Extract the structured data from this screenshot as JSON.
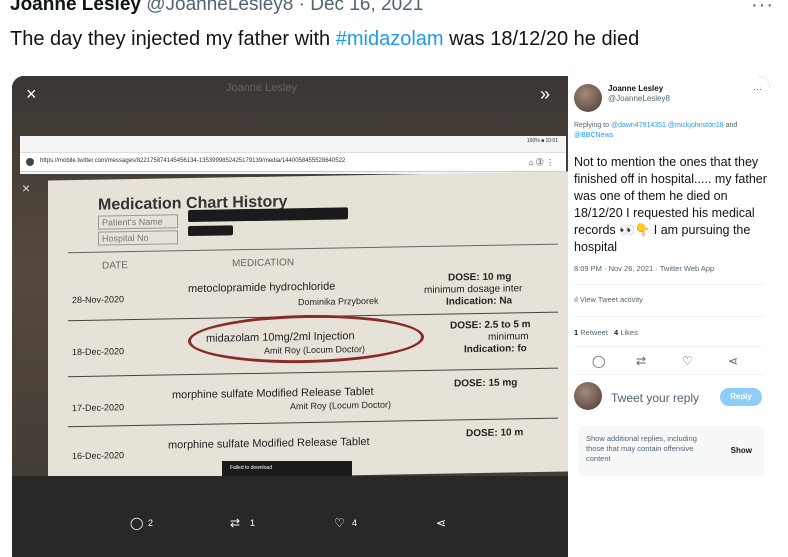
{
  "header": {
    "name": "Joanne Lesley",
    "handle": "@JoanneLesley8",
    "date": "· Dec 16, 2021",
    "more": "···"
  },
  "tweet": {
    "pre": "The day they injected my father with ",
    "hashtag": "#midazolam",
    "post": " was 18/12/20 he died"
  },
  "viewer": {
    "close": "×",
    "next": "»",
    "ghost_name": "Joanne Lesley",
    "browser": {
      "status": "100% ■ 10:01",
      "url": "https://mobile.twitter.com/messages/822175874145456134-1353999852425179139/media/1440058455528640522",
      "icons": "⌂ ⓷ ⋮"
    },
    "close2": "×",
    "document": {
      "title": "Medication Chart History",
      "patient_label": "Patient's Name",
      "hospital_label": "Hospital No",
      "col_date": "DATE",
      "col_med": "MEDICATION",
      "rows": [
        {
          "date": "28-Nov-2020",
          "med": "metoclopramide hydrochloride",
          "doctor": "Dominika Przyborek",
          "dose": "DOSE: 10 mg",
          "dose2": "minimum dosage inter",
          "dose3": "Indication: Na"
        },
        {
          "date": "18-Dec-2020",
          "med": "midazolam 10mg/2ml Injection",
          "doctor": "Amit Roy (Locum Doctor)",
          "dose": "DOSE: 2.5 to 5 m",
          "dose2": "minimum",
          "dose3": "Indication: fo"
        },
        {
          "date": "17-Dec-2020",
          "med": "morphine sulfate Modified Release Tablet",
          "doctor": "Amit Roy (Locum Doctor)",
          "dose": "DOSE: 15 mg"
        },
        {
          "date": "16-Dec-2020",
          "med": "morphine sulfate Modified Release Tablet",
          "doctor": "",
          "dose": "DOSE: 10 m"
        }
      ]
    },
    "failed": "Failed to download",
    "actions": {
      "replies": "2",
      "retweets": "1",
      "likes": "4"
    }
  },
  "side": {
    "name": "Joanne Lesley",
    "handle": "@JoanneLesley8",
    "more": "···",
    "reply_prefix": "Replying to ",
    "reply_to": "@dawn47914351 @mickjohnston18",
    "reply_and": "and ",
    "reply_to2": "@BBCNews",
    "body": "Not to mention the ones that they finished off in hospital..... my father was one of them he died on 18/12/20 I requested his medical records 👀👇 I am pursuing the hospital",
    "meta": "8:09 PM · Nov 26, 2021 · Twitter Web App",
    "view_activity": "View Tweet activity",
    "retweets": "1",
    "retweets_label": "Retweet",
    "likes": "4",
    "likes_label": "Likes",
    "tweet_reply_placeholder": "Tweet your reply",
    "reply_btn": "Reply",
    "additional": "Show additional replies, including those that may contain offensive content",
    "show": "Show"
  },
  "colors": {
    "link": "#1d9bf0",
    "muted": "#536471",
    "reply_btn": "#8ecdf8",
    "circle": "#8a2b2b"
  }
}
